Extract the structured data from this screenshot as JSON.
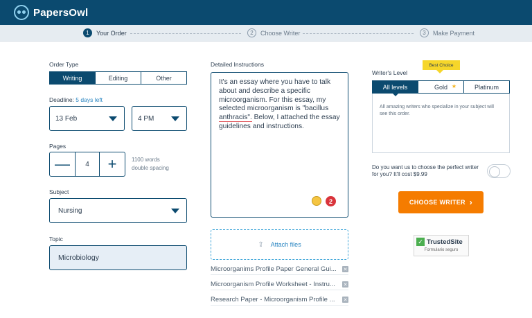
{
  "header": {
    "brand": "PapersOwl"
  },
  "steps": [
    {
      "num": "1",
      "label": "Your Order"
    },
    {
      "num": "2",
      "label": "Choose Writer"
    },
    {
      "num": "3",
      "label": "Make Payment"
    }
  ],
  "order_type": {
    "label": "Order Type",
    "options": [
      "Writing",
      "Editing",
      "Other"
    ],
    "selected": "Writing"
  },
  "deadline": {
    "label": "Deadline:",
    "days_left": "5 days left",
    "date": "13 Feb",
    "time": "4 PM"
  },
  "pages": {
    "label": "Pages",
    "value": "4",
    "minus": "—",
    "plus": "+",
    "hint_line1": "1100 words",
    "hint_line2": "double spacing"
  },
  "subject": {
    "label": "Subject",
    "value": "Nursing"
  },
  "topic": {
    "label": "Topic",
    "value": "Microbiology"
  },
  "instructions": {
    "label": "Detailed Instructions",
    "text_before": "It's an essay where you have to talk about and describe a specific microorganism. For this essay, my selected microorganism is \"bacillus ",
    "text_underlined": "anthracis\".",
    "text_after": " Below, I attached the essay guidelines and instructions.",
    "badge_count": "2"
  },
  "attach": {
    "label": "Attach files",
    "icon": "upload-icon"
  },
  "files": [
    "Microorganims Profile Paper General Gui...",
    "Microorganism Profile Worksheet - Instru...",
    "Research Paper - Microorganism Profile ..."
  ],
  "writers_level": {
    "label": "Writer's Level",
    "best_choice": "Best Choice",
    "options": [
      "All levels",
      "Gold",
      "Platinum"
    ],
    "selected": "All levels",
    "description": "All amazing writers who specialize in your subject will see this order."
  },
  "perfect_writer": {
    "question": "Do you want us to choose the perfect writer for you? It'll cost $9.99"
  },
  "cta": {
    "label": "CHOOSE WRITER",
    "arrow": "›"
  },
  "trusted": {
    "title": "TrustedSite",
    "sub": "Formulario seguro"
  },
  "colors": {
    "brand": "#0b4a6f",
    "accent": "#f57c00",
    "link": "#2a86c2"
  }
}
